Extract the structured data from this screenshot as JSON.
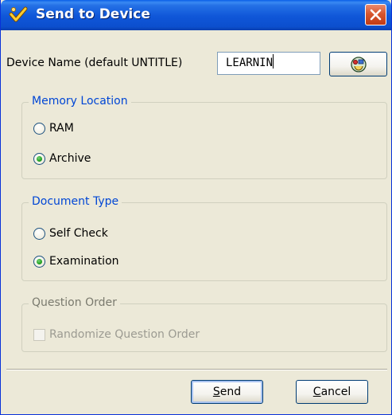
{
  "window": {
    "title": "Send to Device",
    "title_bar_color": "#0c4fce",
    "app_icon": "checkmark-app-icon",
    "close_icon": "close-x-icon"
  },
  "device_name": {
    "label": "Device Name (default UNTITLE)",
    "value": "LEARNIN",
    "browse_icon": "device-connect-icon"
  },
  "memory_location": {
    "legend": "Memory Location",
    "options": [
      {
        "label": "RAM",
        "checked": false
      },
      {
        "label": "Archive",
        "checked": true
      }
    ]
  },
  "document_type": {
    "legend": "Document Type",
    "options": [
      {
        "label": "Self Check",
        "checked": false
      },
      {
        "label": "Examination",
        "checked": true
      }
    ]
  },
  "question_order": {
    "legend": "Question Order",
    "enabled": false,
    "checkbox": {
      "label": "Randomize Question Order",
      "checked": false
    }
  },
  "buttons": {
    "send": {
      "mnemonic": "S",
      "rest": "end"
    },
    "cancel": {
      "mnemonic": "C",
      "rest": "ancel"
    }
  },
  "colors": {
    "group_legend": "#0046d5",
    "dialog_bg": "#ece9d8",
    "disabled_text": "#9c9b92"
  }
}
